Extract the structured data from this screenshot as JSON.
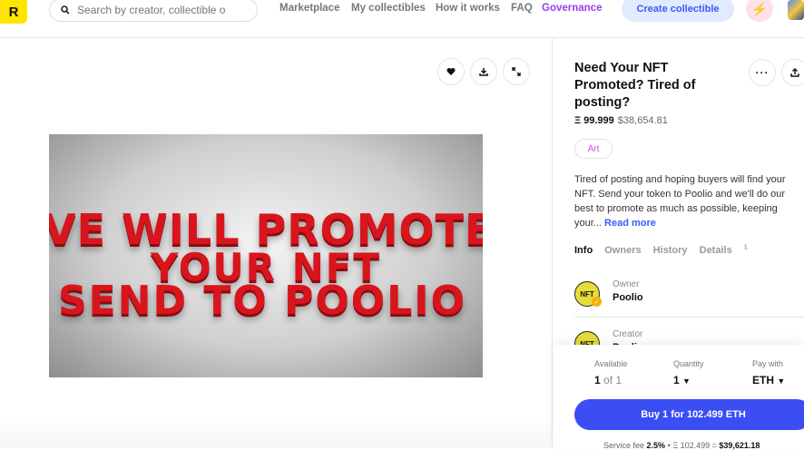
{
  "header": {
    "logo_text": "R",
    "search_placeholder": "Search by creator, collectible o",
    "nav": [
      "Marketplace",
      "My collectibles",
      "How it works",
      "FAQ",
      "Governance"
    ],
    "create_label": "Create collectible",
    "bolt_icon": "⚡"
  },
  "media": {
    "artwork_lines": [
      "VE WILL PROMOTE",
      "YOUR NFT",
      "SEND TO POOLIO"
    ],
    "actions": [
      "heart-icon",
      "download-icon",
      "expand-icon"
    ]
  },
  "item": {
    "title": "Need Your NFT Promoted? Tired of posting?",
    "price_eth": "Ξ 99.999",
    "price_usd": "$38,654.81",
    "category": "Art",
    "description": "Tired of posting and hoping buyers will find your NFT. Send your token to Poolio and we'll do our best to promote as much as possible, keeping your...",
    "read_more": "Read more",
    "tabs": [
      "Info",
      "Owners",
      "History",
      "Details"
    ],
    "details_count": "1",
    "owner_role": "Owner",
    "owner_name": "Poolio",
    "creator_role": "Creator",
    "creator_name": "Poolio",
    "badge_text": "NFT"
  },
  "buy": {
    "available_label": "Available",
    "available_value": "1",
    "available_of": "of 1",
    "quantity_label": "Quantity",
    "quantity_value": "1",
    "pay_label": "Pay with",
    "pay_value": "ETH",
    "button_label": "Buy 1 for 102.499 ETH",
    "fee_label": "Service fee",
    "fee_pct": "2.5%",
    "fee_eth": "Ξ 102.499",
    "fee_usd": "$39,621.18"
  },
  "colors": {
    "accent": "#3b4ef4",
    "brand_yellow": "#fee500",
    "art_red": "#d8151d"
  }
}
